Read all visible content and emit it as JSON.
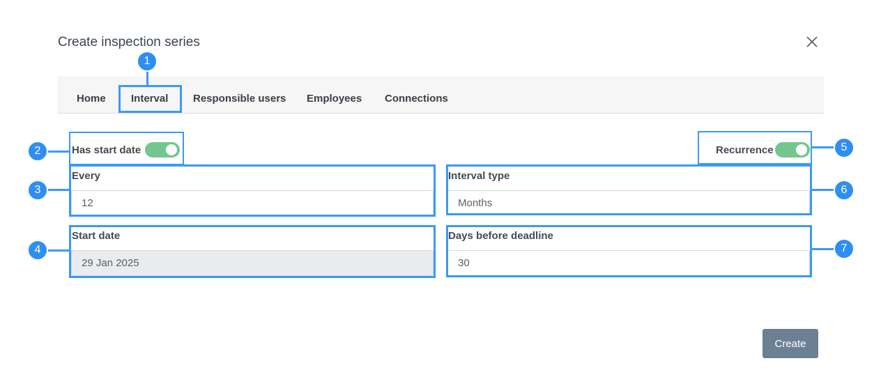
{
  "dialog": {
    "title": "Create inspection series",
    "close_icon": "close-icon"
  },
  "tabs": [
    {
      "label": "Home"
    },
    {
      "label": "Interval",
      "active": true
    },
    {
      "label": "Responsible users"
    },
    {
      "label": "Employees"
    },
    {
      "label": "Connections"
    }
  ],
  "form": {
    "has_start_date": {
      "label": "Has start date",
      "checked": true
    },
    "recurrence": {
      "label": "Recurrence",
      "checked": true
    },
    "every": {
      "label": "Every",
      "value": "12"
    },
    "interval_type": {
      "label": "Interval type",
      "value": "Months"
    },
    "start_date": {
      "label": "Start date",
      "value": "29 Jan 2025",
      "disabled": true
    },
    "days_before_deadline": {
      "label": "Days before deadline",
      "value": "30"
    }
  },
  "actions": {
    "create_label": "Create"
  },
  "annotations": [
    "1",
    "2",
    "3",
    "4",
    "5",
    "6",
    "7"
  ],
  "colors": {
    "accent": "#3b99f5",
    "toggle_on": "#74c690",
    "create_button": "#6c8093"
  }
}
